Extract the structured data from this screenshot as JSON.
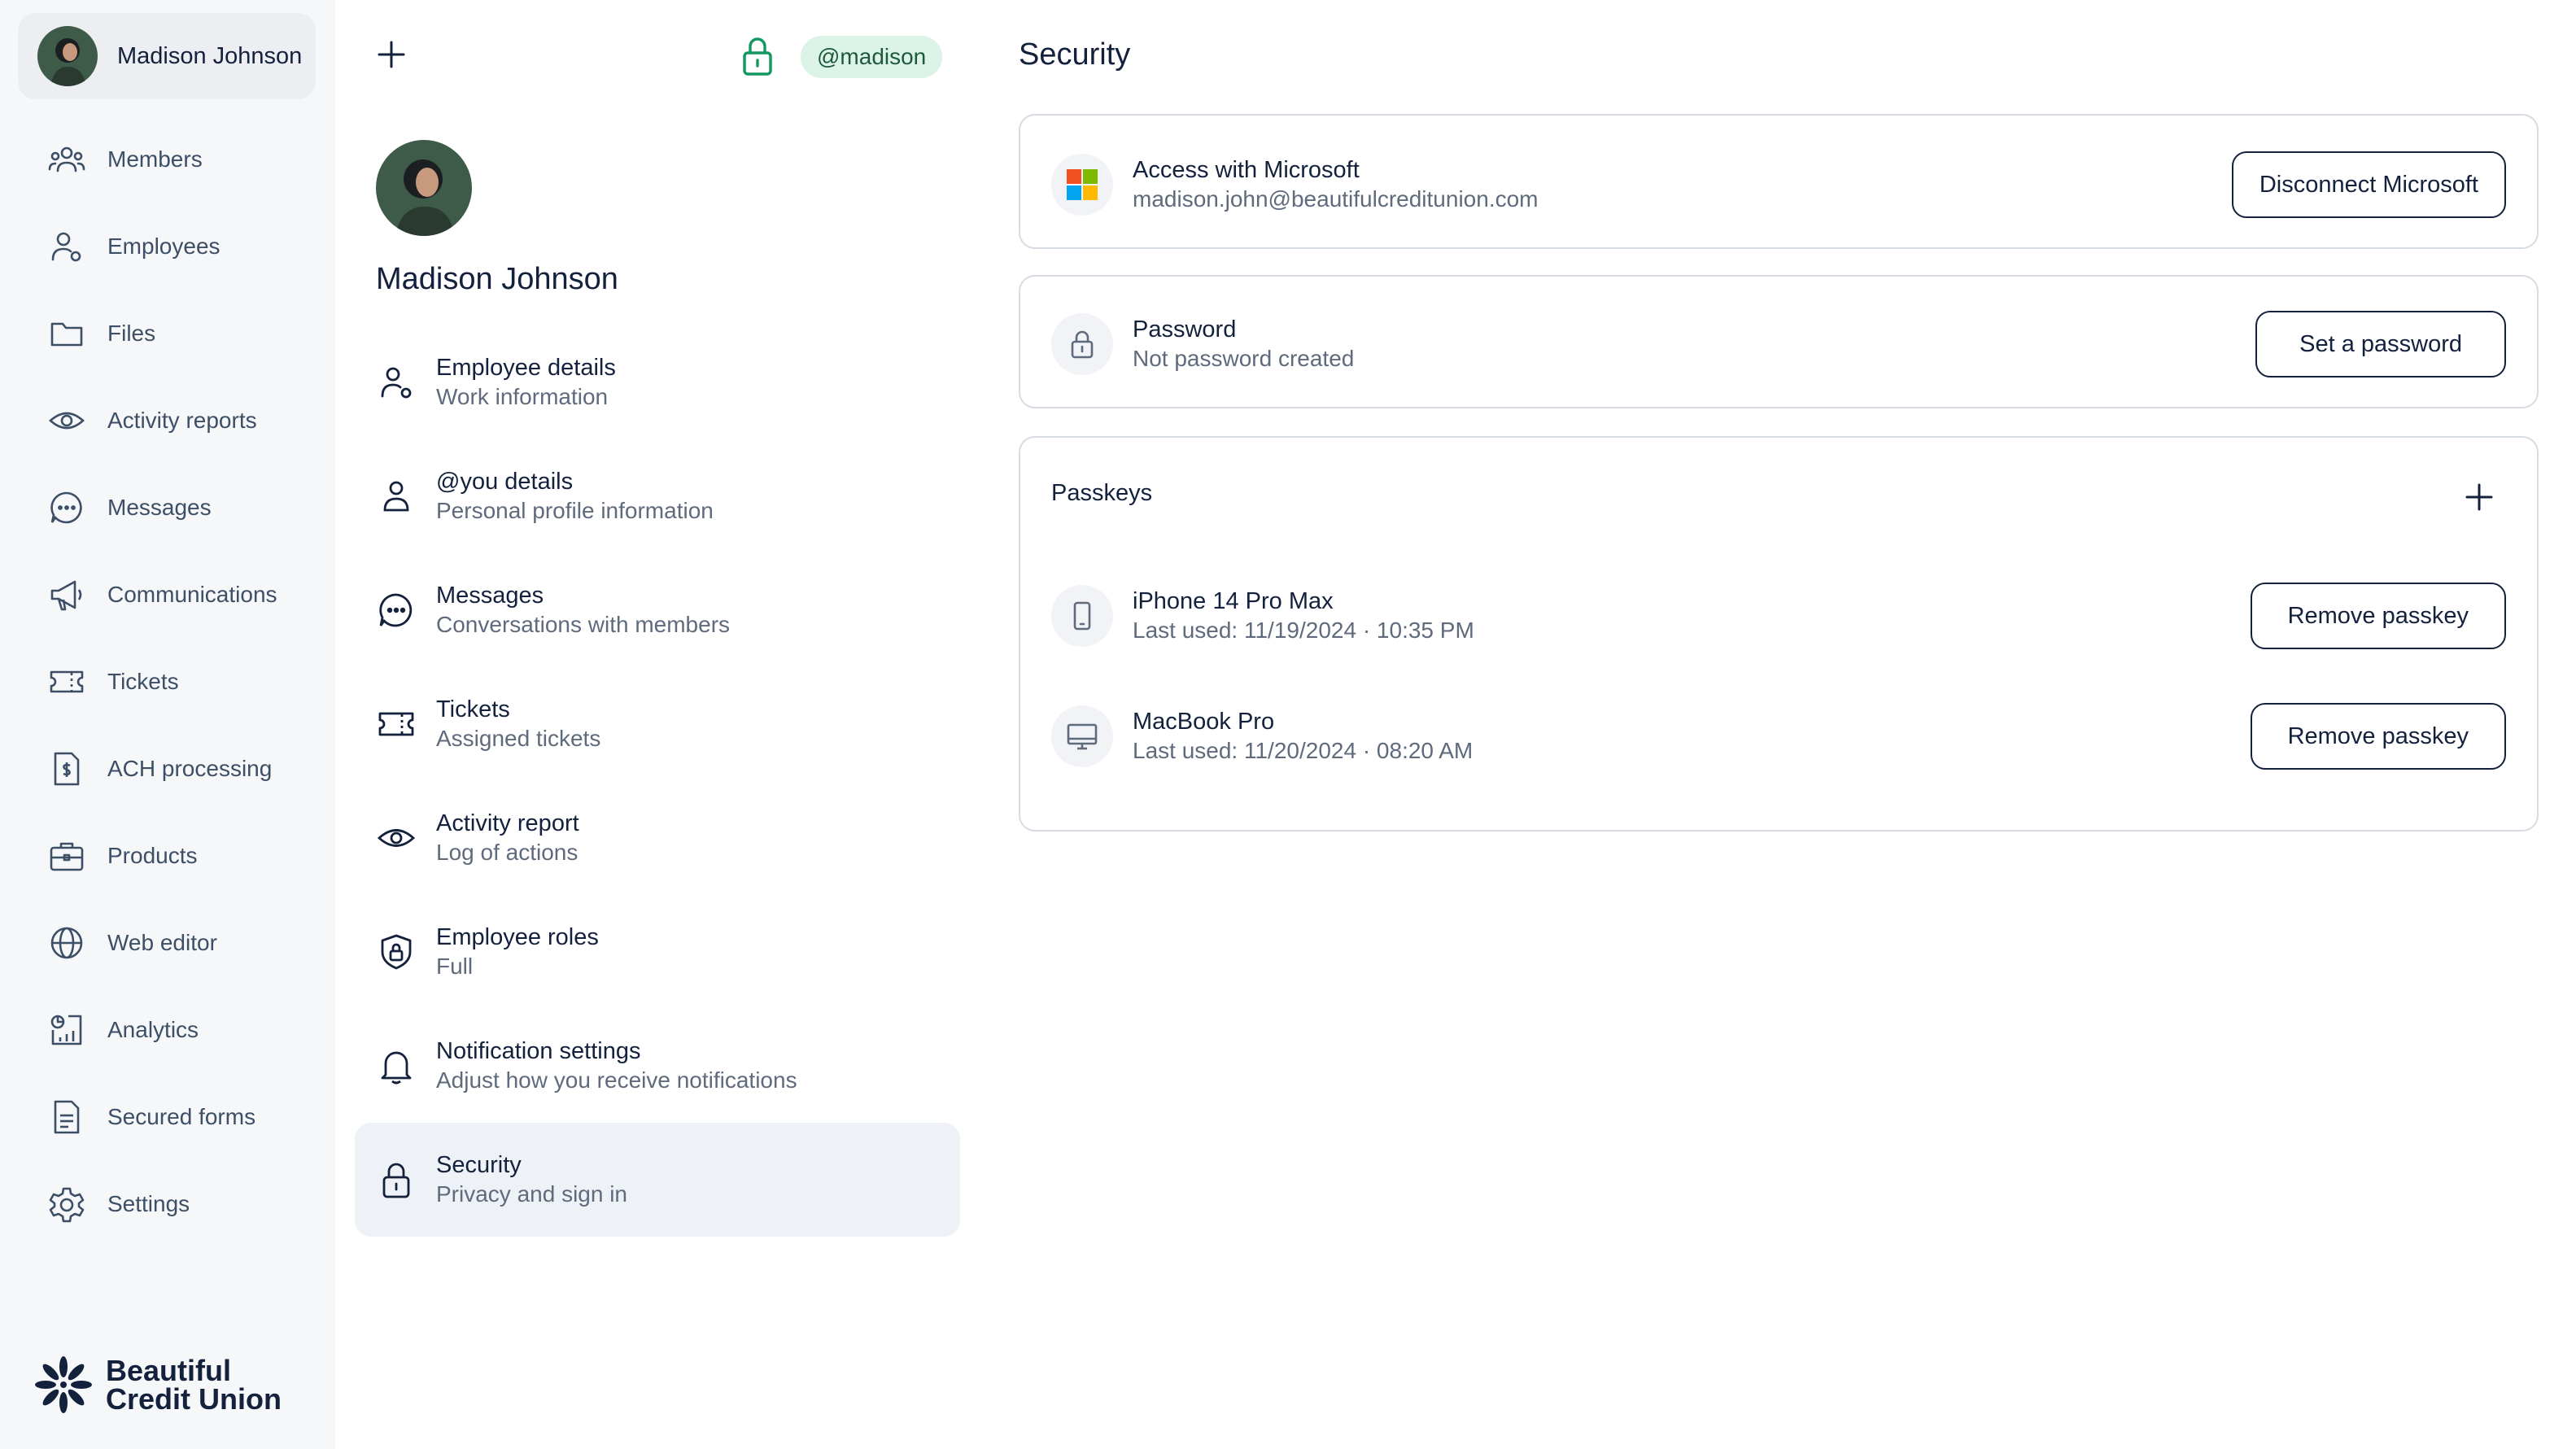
{
  "user": {
    "name": "Madison Johnson",
    "handle": "@madison"
  },
  "nav": {
    "items": [
      {
        "label": "Members",
        "icon": "members-icon"
      },
      {
        "label": "Employees",
        "icon": "employee-icon"
      },
      {
        "label": "Files",
        "icon": "folder-icon"
      },
      {
        "label": "Activity reports",
        "icon": "eye-icon"
      },
      {
        "label": "Messages",
        "icon": "chat-icon"
      },
      {
        "label": "Communications",
        "icon": "megaphone-icon"
      },
      {
        "label": "Tickets",
        "icon": "ticket-icon"
      },
      {
        "label": "ACH processing",
        "icon": "dollar-document-icon"
      },
      {
        "label": "Products",
        "icon": "briefcase-icon"
      },
      {
        "label": "Web editor",
        "icon": "globe-icon"
      },
      {
        "label": "Analytics",
        "icon": "analytics-icon"
      },
      {
        "label": "Secured forms",
        "icon": "form-icon"
      },
      {
        "label": "Settings",
        "icon": "gear-icon"
      }
    ]
  },
  "brand": {
    "line1": "Beautiful",
    "line2": "Credit Union"
  },
  "profile_menu": [
    {
      "title": "Employee details",
      "subtitle": "Work information",
      "icon": "employee-details-icon"
    },
    {
      "title": "@you details",
      "subtitle": "Personal profile information",
      "icon": "person-icon"
    },
    {
      "title": "Messages",
      "subtitle": "Conversations with members",
      "icon": "chat-icon"
    },
    {
      "title": "Tickets",
      "subtitle": "Assigned tickets",
      "icon": "ticket-icon"
    },
    {
      "title": "Activity report",
      "subtitle": "Log of actions",
      "icon": "eye-icon"
    },
    {
      "title": "Employee roles",
      "subtitle": "Full",
      "icon": "shield-lock-icon"
    },
    {
      "title": "Notification settings",
      "subtitle": "Adjust how you receive notifications",
      "icon": "bell-icon"
    },
    {
      "title": "Security",
      "subtitle": "Privacy and sign in",
      "icon": "lock-icon"
    }
  ],
  "security": {
    "title": "Security",
    "microsoft": {
      "title": "Access with Microsoft",
      "email": "madison.john@beautifulcreditunion.com",
      "button": "Disconnect Microsoft"
    },
    "password": {
      "title": "Password",
      "status": "Not password created",
      "button": "Set a password"
    },
    "passkeys": {
      "title": "Passkeys",
      "items": [
        {
          "device": "iPhone 14 Pro Max",
          "last_used": "Last used: 11/19/2024 · 10:35 PM",
          "button": "Remove passkey",
          "icon": "phone-icon"
        },
        {
          "device": "MacBook Pro",
          "last_used": "Last used: 11/20/2024 · 08:20 AM",
          "button": "Remove passkey",
          "icon": "monitor-icon"
        }
      ]
    }
  },
  "colors": {
    "accent": "#129760",
    "badge_bg": "#dcf3e7",
    "text_primary": "#14213d",
    "text_muted": "#5f6b7c",
    "nav_bg": "#f6f7f9"
  }
}
